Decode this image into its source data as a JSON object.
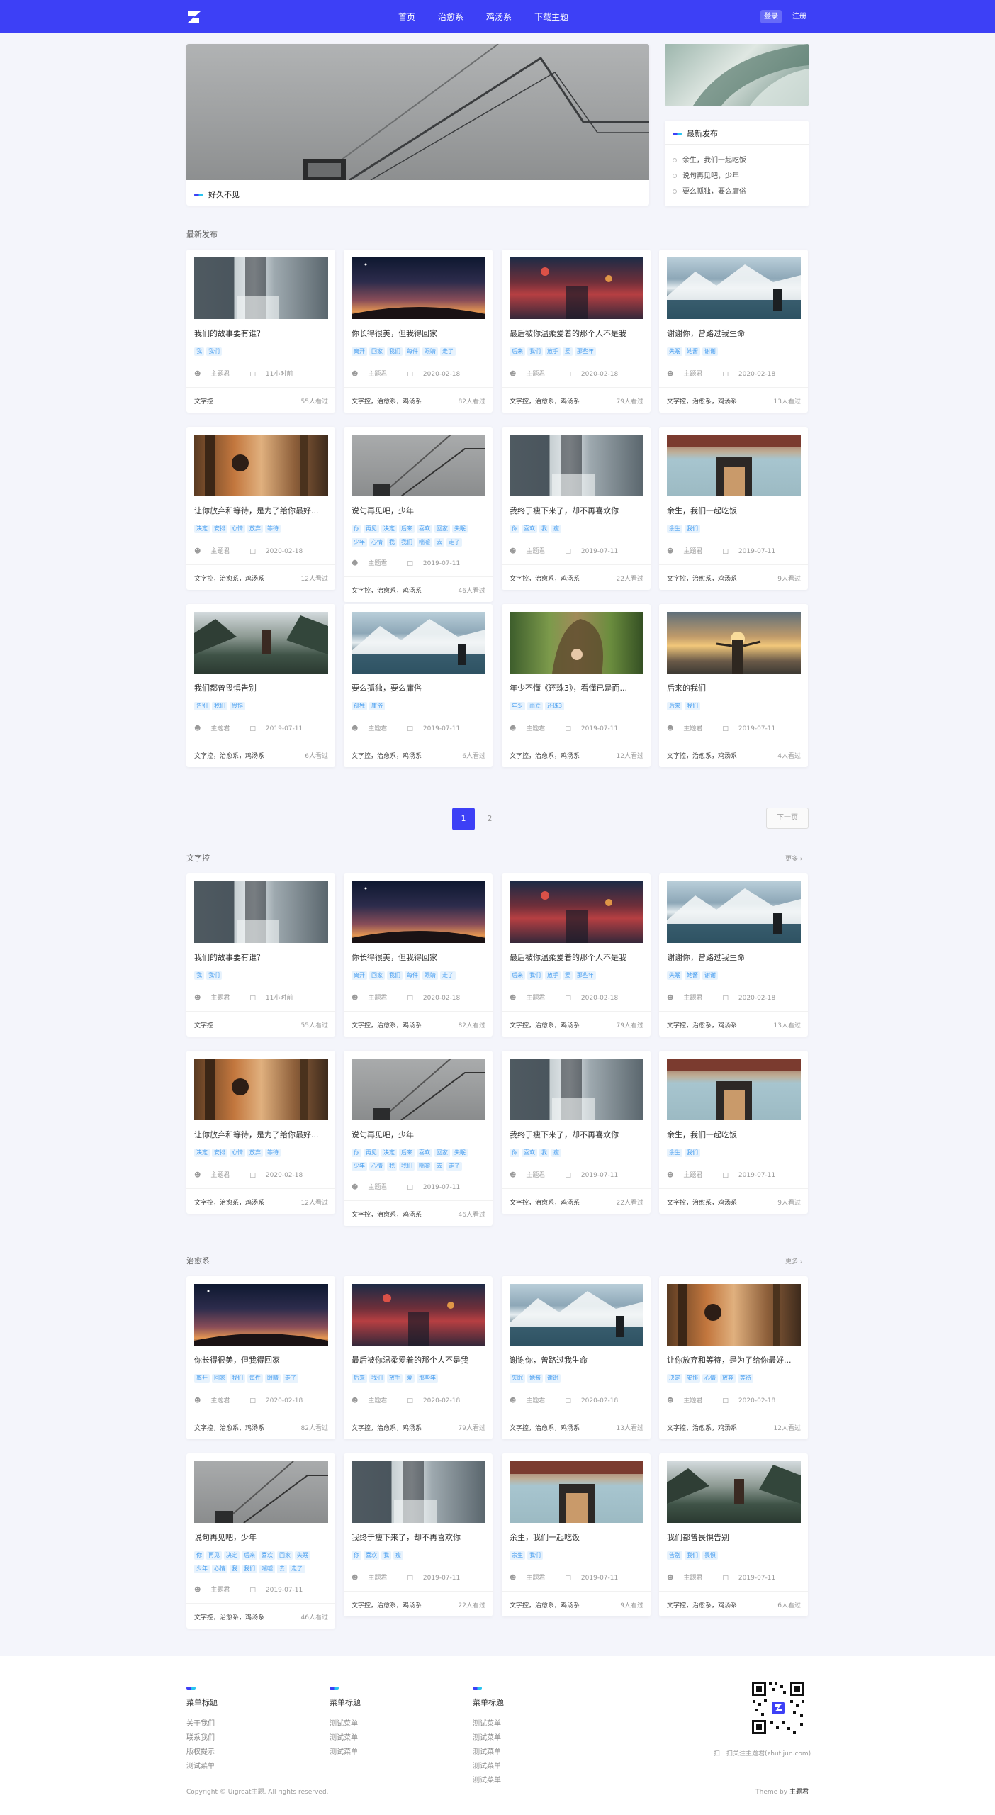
{
  "header": {
    "nav": [
      "首页",
      "治愈系",
      "鸡汤系",
      "下载主题"
    ],
    "login": "登录",
    "register": "注册",
    "bg_color": "#3d40f6"
  },
  "hero": {
    "caption": "好久不见"
  },
  "sidebar": {
    "heading": "最新发布",
    "items": [
      "余生，我们一起吃饭",
      "说句再见吧，少年",
      "要么孤独，要么庸俗"
    ]
  },
  "sections": {
    "latest_title": "最新发布",
    "wenzi_title": "文字控",
    "zhiyu_title": "治愈系",
    "more": "更多 ›"
  },
  "pagination": {
    "current": "1",
    "next_page": "2",
    "next": "下一页"
  },
  "latest_cards": [
    {
      "title": "我们的故事要有谁？",
      "tags": [
        "我",
        "我们"
      ],
      "author": "主题君",
      "date": "11小时前",
      "category": "文字控",
      "views": "55人看过",
      "icon": "corridor"
    },
    {
      "title": "你长得很美，但我得回家",
      "tags": [
        "离开",
        "回家",
        "我们",
        "每件",
        "眼睛",
        "走了"
      ],
      "author": "主题君",
      "date": "2020-02-18",
      "category": "文字控，治愈系，鸡汤系",
      "views": "82人看过",
      "icon": "sunset"
    },
    {
      "title": "最后被你温柔爱着的那个人不是我",
      "tags": [
        "后来",
        "我们",
        "放手",
        "爱",
        "那些年"
      ],
      "author": "主题君",
      "date": "2020-02-18",
      "category": "文字控，治愈系，鸡汤系",
      "views": "79人看过",
      "icon": "lanterns"
    },
    {
      "title": "谢谢你，曾路过我生命",
      "tags": [
        "失眠",
        "她酱",
        "谢谢"
      ],
      "author": "主题君",
      "date": "2020-02-18",
      "category": "文字控，治愈系，鸡汤系",
      "views": "13人看过",
      "icon": "mountain"
    },
    {
      "title": "让你放弃和等待，是为了给你最好...",
      "tags": [
        "决定",
        "安排",
        "心情",
        "放弃",
        "等待"
      ],
      "author": "主题君",
      "date": "2020-02-18",
      "category": "文字控，治愈系，鸡汤系",
      "views": "12人看过",
      "icon": "forest"
    },
    {
      "title": "说句再见吧，少年",
      "tags": [
        "你",
        "再见",
        "决定",
        "后来",
        "喜欢",
        "回家",
        "失眠",
        "少年",
        "心情",
        "我",
        "我们",
        "喘嘘",
        "去",
        "走了"
      ],
      "author": "主题君",
      "date": "2019-07-11",
      "category": "文字控，治愈系，鸡汤系",
      "views": "46人看过",
      "icon": "stairs"
    },
    {
      "title": "我终于瘦下来了，却不再喜欢你",
      "tags": [
        "你",
        "喜欢",
        "我",
        "瘦"
      ],
      "author": "主题君",
      "date": "2019-07-11",
      "category": "文字控，治愈系，鸡汤系",
      "views": "22人看过",
      "icon": "corridor"
    },
    {
      "title": "余生，我们一起吃饭",
      "tags": [
        "余生",
        "我们"
      ],
      "author": "主题君",
      "date": "2019-07-11",
      "category": "文字控，治愈系，鸡汤系",
      "views": "9人看过",
      "icon": "door"
    },
    {
      "title": "我们都曾畏惧告别",
      "tags": [
        "告别",
        "我们",
        "畏惧"
      ],
      "author": "主题君",
      "date": "2019-07-11",
      "category": "文字控，治愈系，鸡汤系",
      "views": "6人看过",
      "icon": "lake"
    },
    {
      "title": "要么孤独，要么庸俗",
      "tags": [
        "孤独",
        "庸俗"
      ],
      "author": "主题君",
      "date": "2019-07-11",
      "category": "文字控，治愈系，鸡汤系",
      "views": "6人看过",
      "icon": "mountain"
    },
    {
      "title": "年少不懂《还珠3》，看懂已是而...",
      "tags": [
        "年少",
        "而立",
        "还珠3"
      ],
      "author": "主题君",
      "date": "2019-07-11",
      "category": "文字控，治愈系，鸡汤系",
      "views": "12人看过",
      "icon": "tree"
    },
    {
      "title": "后来的我们",
      "tags": [
        "后来",
        "我们"
      ],
      "author": "主题君",
      "date": "2019-07-11",
      "category": "文字控，治愈系，鸡汤系",
      "views": "4人看过",
      "icon": "sunrise"
    }
  ],
  "wenzi_cards": [
    {
      "title": "我们的故事要有谁？",
      "tags": [
        "我",
        "我们"
      ],
      "author": "主题君",
      "date": "11小时前",
      "category": "文字控",
      "views": "55人看过",
      "icon": "corridor"
    },
    {
      "title": "你长得很美，但我得回家",
      "tags": [
        "离开",
        "回家",
        "我们",
        "每件",
        "眼睛",
        "走了"
      ],
      "author": "主题君",
      "date": "2020-02-18",
      "category": "文字控，治愈系，鸡汤系",
      "views": "82人看过",
      "icon": "sunset"
    },
    {
      "title": "最后被你温柔爱着的那个人不是我",
      "tags": [
        "后来",
        "我们",
        "放手",
        "爱",
        "那些年"
      ],
      "author": "主题君",
      "date": "2020-02-18",
      "category": "文字控，治愈系，鸡汤系",
      "views": "79人看过",
      "icon": "lanterns"
    },
    {
      "title": "谢谢你，曾路过我生命",
      "tags": [
        "失眠",
        "她酱",
        "谢谢"
      ],
      "author": "主题君",
      "date": "2020-02-18",
      "category": "文字控，治愈系，鸡汤系",
      "views": "13人看过",
      "icon": "mountain"
    },
    {
      "title": "让你放弃和等待，是为了给你最好...",
      "tags": [
        "决定",
        "安排",
        "心情",
        "放弃",
        "等待"
      ],
      "author": "主题君",
      "date": "2020-02-18",
      "category": "文字控，治愈系，鸡汤系",
      "views": "12人看过",
      "icon": "forest"
    },
    {
      "title": "说句再见吧，少年",
      "tags": [
        "你",
        "再见",
        "决定",
        "后来",
        "喜欢",
        "回家",
        "失眠",
        "少年",
        "心情",
        "我",
        "我们",
        "喘嘘",
        "去",
        "走了"
      ],
      "author": "主题君",
      "date": "2019-07-11",
      "category": "文字控，治愈系，鸡汤系",
      "views": "46人看过",
      "icon": "stairs"
    },
    {
      "title": "我终于瘦下来了，却不再喜欢你",
      "tags": [
        "你",
        "喜欢",
        "我",
        "瘦"
      ],
      "author": "主题君",
      "date": "2019-07-11",
      "category": "文字控，治愈系，鸡汤系",
      "views": "22人看过",
      "icon": "corridor"
    },
    {
      "title": "余生，我们一起吃饭",
      "tags": [
        "余生",
        "我们"
      ],
      "author": "主题君",
      "date": "2019-07-11",
      "category": "文字控，治愈系，鸡汤系",
      "views": "9人看过",
      "icon": "door"
    }
  ],
  "zhiyu_cards": [
    {
      "title": "你长得很美，但我得回家",
      "tags": [
        "离开",
        "回家",
        "我们",
        "每件",
        "眼睛",
        "走了"
      ],
      "author": "主题君",
      "date": "2020-02-18",
      "category": "文字控，治愈系，鸡汤系",
      "views": "82人看过",
      "icon": "sunset"
    },
    {
      "title": "最后被你温柔爱着的那个人不是我",
      "tags": [
        "后来",
        "我们",
        "放手",
        "爱",
        "那些年"
      ],
      "author": "主题君",
      "date": "2020-02-18",
      "category": "文字控，治愈系，鸡汤系",
      "views": "79人看过",
      "icon": "lanterns"
    },
    {
      "title": "谢谢你，曾路过我生命",
      "tags": [
        "失眠",
        "她酱",
        "谢谢"
      ],
      "author": "主题君",
      "date": "2020-02-18",
      "category": "文字控，治愈系，鸡汤系",
      "views": "13人看过",
      "icon": "mountain"
    },
    {
      "title": "让你放弃和等待，是为了给你最好...",
      "tags": [
        "决定",
        "安排",
        "心情",
        "放弃",
        "等待"
      ],
      "author": "主题君",
      "date": "2020-02-18",
      "category": "文字控，治愈系，鸡汤系",
      "views": "12人看过",
      "icon": "forest"
    },
    {
      "title": "说句再见吧，少年",
      "tags": [
        "你",
        "再见",
        "决定",
        "后来",
        "喜欢",
        "回家",
        "失眠",
        "少年",
        "心情",
        "我",
        "我们",
        "喘嘘",
        "去",
        "走了"
      ],
      "author": "主题君",
      "date": "2019-07-11",
      "category": "文字控，治愈系，鸡汤系",
      "views": "46人看过",
      "icon": "stairs"
    },
    {
      "title": "我终于瘦下来了，却不再喜欢你",
      "tags": [
        "你",
        "喜欢",
        "我",
        "瘦"
      ],
      "author": "主题君",
      "date": "2019-07-11",
      "category": "文字控，治愈系，鸡汤系",
      "views": "22人看过",
      "icon": "corridor"
    },
    {
      "title": "余生，我们一起吃饭",
      "tags": [
        "余生",
        "我们"
      ],
      "author": "主题君",
      "date": "2019-07-11",
      "category": "文字控，治愈系，鸡汤系",
      "views": "9人看过",
      "icon": "door"
    },
    {
      "title": "我们都曾畏惧告别",
      "tags": [
        "告别",
        "我们",
        "畏惧"
      ],
      "author": "主题君",
      "date": "2019-07-11",
      "category": "文字控，治愈系，鸡汤系",
      "views": "6人看过",
      "icon": "lake"
    }
  ],
  "footer": {
    "columns": [
      {
        "heading": "菜单标题",
        "items": [
          "关于我们",
          "联系我们",
          "版权提示",
          "测试菜单"
        ]
      },
      {
        "heading": "菜单标题",
        "items": [
          "测试菜单",
          "测试菜单",
          "测试菜单"
        ]
      },
      {
        "heading": "菜单标题",
        "items": [
          "测试菜单",
          "测试菜单",
          "测试菜单",
          "测试菜单",
          "测试菜单"
        ]
      }
    ],
    "qr_caption": "扫一扫关注主题君(zhutijun.com)",
    "copyright": "Copyright © Uigreat主题. All rights reserved.",
    "theme_by_prefix": "Theme by",
    "theme_by_name": "主题君"
  }
}
